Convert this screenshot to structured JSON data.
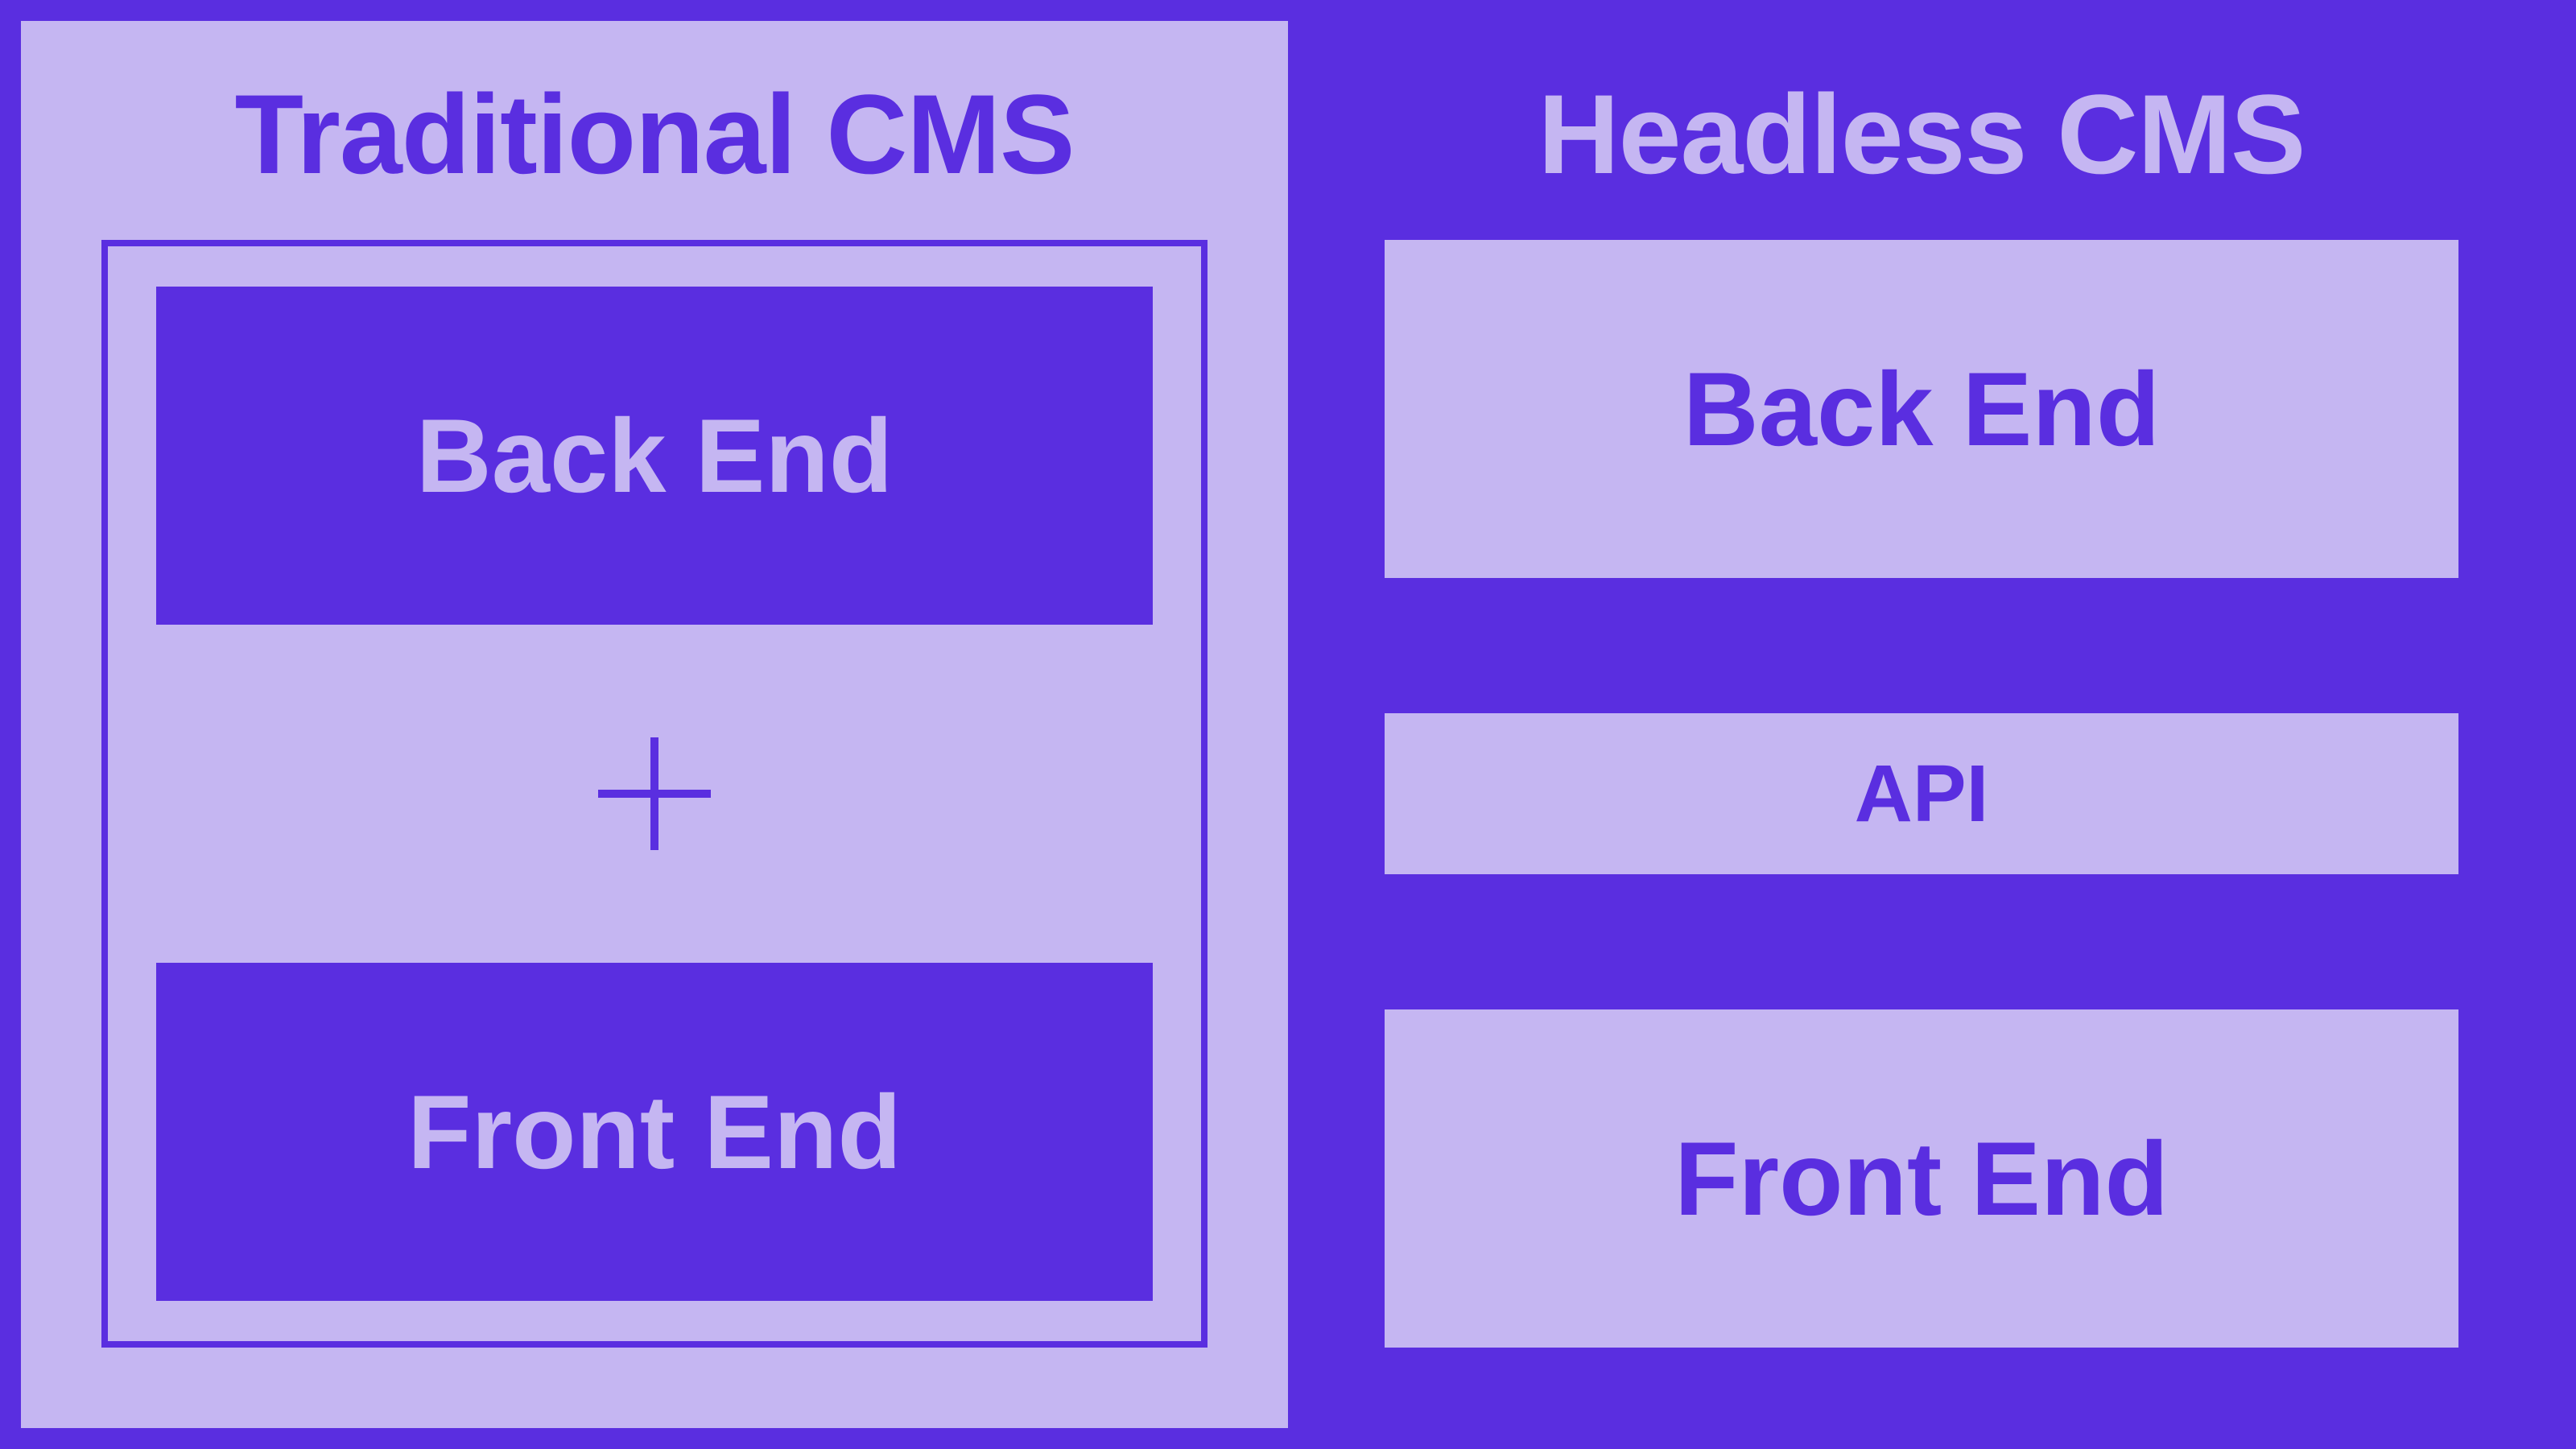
{
  "left": {
    "title": "Traditional CMS",
    "backend": "Back End",
    "frontend": "Front End"
  },
  "right": {
    "title": "Headless CMS",
    "backend": "Back End",
    "api": "API",
    "frontend": "Front End"
  },
  "colors": {
    "accent": "#5a2ee0",
    "light": "#c5b6f2"
  }
}
